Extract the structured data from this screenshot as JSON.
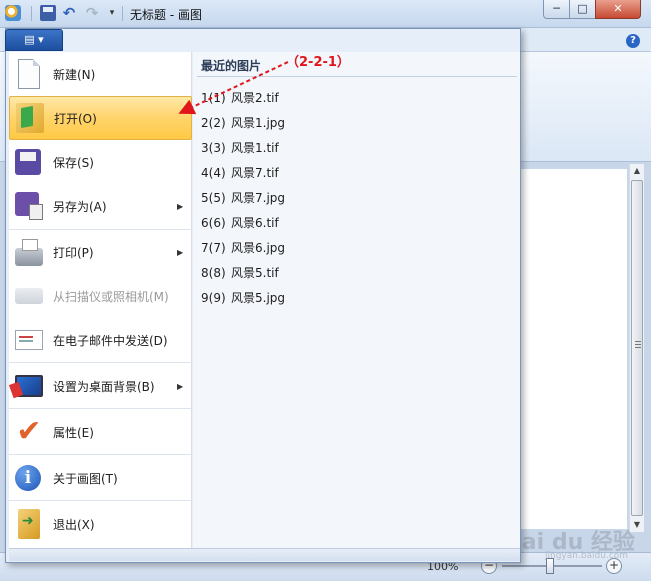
{
  "window": {
    "title": "无标题 - 画图",
    "min_glyph": "─",
    "max_glyph": "□",
    "close_glyph": "✕"
  },
  "toolbar": {
    "undo_glyph": "↶",
    "redo_glyph": "↷",
    "dropdown_glyph": "▾"
  },
  "ribbon": {
    "menu_button_glyph": "▤ ▾",
    "help_glyph": "?"
  },
  "menu": {
    "items": [
      {
        "label": "新建(N)",
        "icon": "new-document-icon"
      },
      {
        "label": "打开(O)",
        "icon": "open-folder-icon",
        "highlighted": true
      },
      {
        "label": "保存(S)",
        "icon": "save-disk-icon"
      },
      {
        "label": "另存为(A)",
        "icon": "save-as-icon",
        "submenu": true
      },
      {
        "label": "打印(P)",
        "icon": "printer-icon",
        "submenu": true
      },
      {
        "label": "从扫描仪或照相机(M)",
        "icon": "scanner-icon",
        "disabled": true
      },
      {
        "label": "在电子邮件中发送(D)",
        "icon": "email-icon"
      },
      {
        "label": "设置为桌面背景(B)",
        "icon": "desktop-background-icon",
        "submenu": true
      },
      {
        "label": "属性(E)",
        "icon": "checkmark-icon"
      },
      {
        "label": "关于画图(T)",
        "icon": "info-icon"
      },
      {
        "label": "退出(X)",
        "icon": "exit-icon"
      }
    ],
    "submenu_arrow": "▶"
  },
  "recent": {
    "title": "最近的图片",
    "files": [
      {
        "num": "1(1)",
        "name": "风景2.tif"
      },
      {
        "num": "2(2)",
        "name": "风景1.jpg"
      },
      {
        "num": "3(3)",
        "name": "风景1.tif"
      },
      {
        "num": "4(4)",
        "name": "风景7.tif"
      },
      {
        "num": "5(5)",
        "name": "风景7.jpg"
      },
      {
        "num": "6(6)",
        "name": "风景6.tif"
      },
      {
        "num": "7(7)",
        "name": "风景6.jpg"
      },
      {
        "num": "8(8)",
        "name": "风景5.tif"
      },
      {
        "num": "9(9)",
        "name": "风景5.jpg"
      }
    ]
  },
  "annotation": {
    "text": "（2-2-1）",
    "color": "#e0161b"
  },
  "statusbar": {
    "zoom": "100%",
    "zoom_minus": "−",
    "zoom_plus": "+"
  },
  "scrollbar": {
    "up_glyph": "▲",
    "down_glyph": "▼"
  },
  "watermark": {
    "text": "Bai du 经验",
    "sub": "jingyan.baidu.com"
  }
}
